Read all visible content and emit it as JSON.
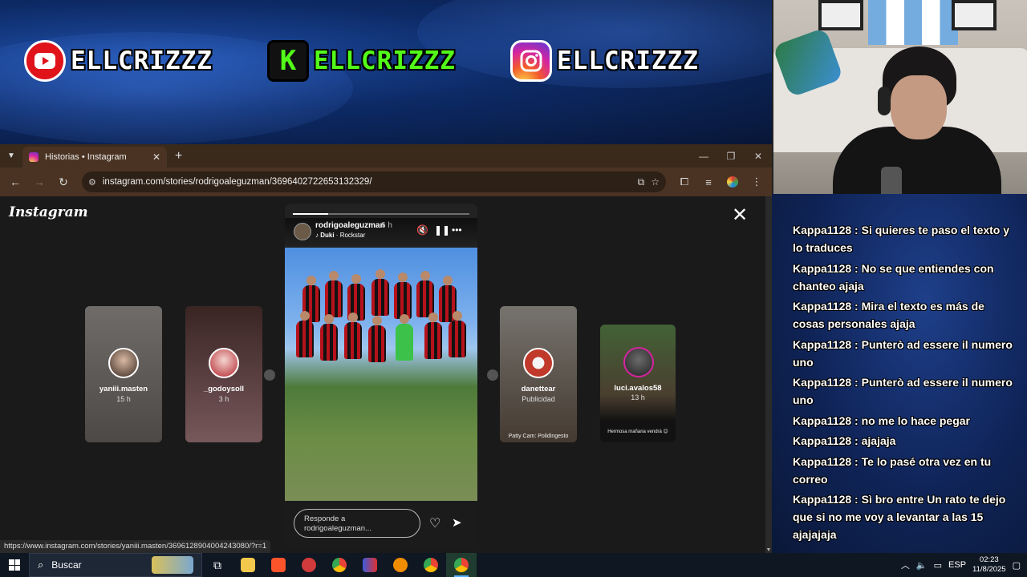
{
  "banner": {
    "youtube_handle": "ELLCRIZZZ",
    "kick_letter": "K",
    "kick_handle": "ELLCRIZZZ",
    "instagram_handle": "ELLCRIZZZ",
    "youtube_color": "#e0121a",
    "kick_color": "#53fc18"
  },
  "browser": {
    "tab_title": "Historias • Instagram",
    "url": "instagram.com/stories/rodrigoaleguzman/3696402722653132329/",
    "status_url": "https://www.instagram.com/stories/yaniii.masten/3696128904004243080/?r=1"
  },
  "instagram": {
    "wordmark": "Instagram",
    "current_story": {
      "username": "rodrigoaleguzman",
      "time": "6 h",
      "artist": "Duki",
      "song": "Rockstar",
      "progress": 0.2,
      "reply_placeholder": "Responde a rodrigoaleguzman..."
    },
    "side_stories": [
      {
        "username": "yaniii.masten",
        "time": "15 h",
        "caption": ""
      },
      {
        "username": "_godoysoll",
        "time": "3 h",
        "caption": ""
      },
      {
        "username": "danettear",
        "time": "Publicidad",
        "caption": "Patty Cam: Polidingesto"
      },
      {
        "username": "luci.avalos58",
        "time": "13 h",
        "caption": "Hermosa mañana vendrá 😊"
      }
    ]
  },
  "chat": {
    "messages": [
      {
        "user": "Kappa1128",
        "text": "Si quieres te paso el texto y lo traduces"
      },
      {
        "user": "Kappa1128",
        "text": "No se que entiendes con chanteo ajaja"
      },
      {
        "user": "Kappa1128",
        "text": "Mira el texto es más de cosas personales ajaja"
      },
      {
        "user": "Kappa1128",
        "text": "Punterò ad essere il numero uno"
      },
      {
        "user": "Kappa1128",
        "text": "Punterò ad essere il numero uno"
      },
      {
        "user": "Kappa1128",
        "text": "no me lo hace pegar"
      },
      {
        "user": "Kappa1128",
        "text": "ajajaja"
      },
      {
        "user": "Kappa1128",
        "text": "Te lo pasé otra vez en tu correo"
      },
      {
        "user": "Kappa1128",
        "text": "Sì bro entre Un rato te dejo que si no me voy a levantar a las 15 ajajajaja"
      }
    ]
  },
  "taskbar": {
    "search_label": "Buscar",
    "language": "ESP",
    "time": "02:23",
    "date": "11/8/2025"
  }
}
